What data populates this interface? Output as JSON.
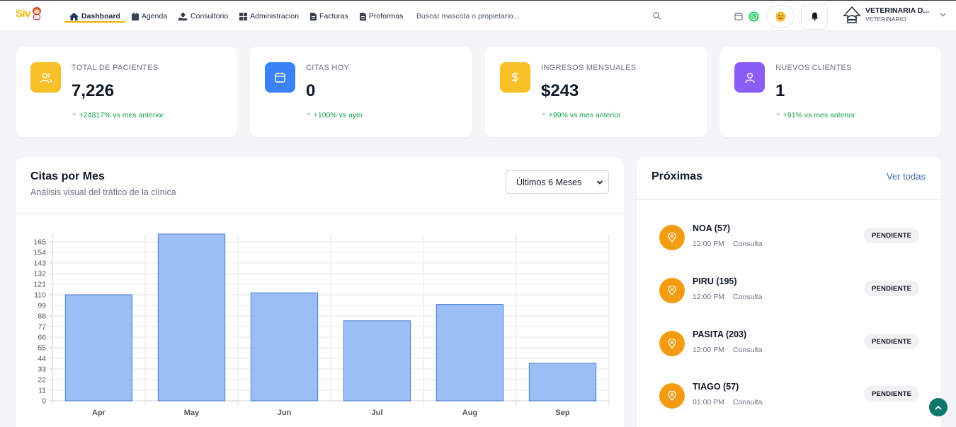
{
  "app": {
    "logo_text": "Siv"
  },
  "nav": {
    "items": [
      {
        "label": "Dashboard",
        "icon": "home-icon",
        "active": true
      },
      {
        "label": "Agenda",
        "icon": "calendar-icon"
      },
      {
        "label": "Consultorio",
        "icon": "hand-medical-icon"
      },
      {
        "label": "Administracion",
        "icon": "grid-icon"
      },
      {
        "label": "Facturas",
        "icon": "invoice-icon"
      },
      {
        "label": "Proformas",
        "icon": "document-icon"
      }
    ],
    "search_placeholder": "Buscar mascota o propietario..."
  },
  "user": {
    "name": "VETERINARIA D...",
    "role": "VETERINARIO"
  },
  "stats": [
    {
      "label": "TOTAL DE PACIENTES",
      "value": "7,226",
      "trend": "+24817% vs mes anterior",
      "color": "#f6c026",
      "icon": "users-icon"
    },
    {
      "label": "CITAS HOY",
      "value": "0",
      "trend": "+100% vs ayer",
      "color": "#3b82f6",
      "icon": "calendar-icon"
    },
    {
      "label": "INGRESOS MENSUALES",
      "value": "$243",
      "trend": "+99% vs mes anterior",
      "color": "#f6c026",
      "icon": "dollar-icon"
    },
    {
      "label": "NUEVOS CLIENTES",
      "value": "1",
      "trend": "+91% vs mes anterior",
      "color": "#8b5cf6",
      "icon": "user-icon"
    }
  ],
  "chart": {
    "title": "Citas por Mes",
    "subtitle": "Análisis visual del tráfico de la clínica",
    "range_label": "Últimos 6 Meses"
  },
  "chart_data": {
    "type": "bar",
    "categories": [
      "Apr",
      "May",
      "Jun",
      "Jul",
      "Aug",
      "Sep"
    ],
    "values": [
      110,
      173,
      112,
      83,
      100,
      39
    ],
    "yticks": [
      0,
      11,
      22,
      33,
      44,
      55,
      66,
      77,
      88,
      99,
      110,
      121,
      132,
      143,
      154,
      165
    ],
    "ylim": [
      0,
      173
    ],
    "grid": true,
    "bar_color": "#9bbff5",
    "bar_border": "#4a7dd6"
  },
  "proximas": {
    "title": "Próximas",
    "link": "Ver todas",
    "items": [
      {
        "name": "NOA (57)",
        "time": "12:00 PM",
        "type": "Consulta",
        "status": "PENDIENTE"
      },
      {
        "name": "PIRU (195)",
        "time": "12:00 PM",
        "type": "Consulta",
        "status": "PENDIENTE"
      },
      {
        "name": "PASITA (203)",
        "time": "12:00 PM",
        "type": "Consulta",
        "status": "PENDIENTE"
      },
      {
        "name": "TIAGO (57)",
        "time": "01:00 PM",
        "type": "Consulta",
        "status": "PENDIENTE"
      }
    ]
  },
  "colors": {
    "accent": "#f0b400",
    "appointment_icon": "#f39c12",
    "trend": "#16a34a",
    "whatsapp": "#25d366",
    "scroll_top": "#0f766e"
  }
}
